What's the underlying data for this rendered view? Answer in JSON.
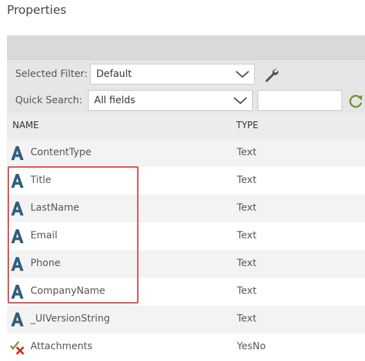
{
  "page": {
    "title": "Properties"
  },
  "filters": {
    "selected_filter_label": "Selected Filter:",
    "selected_filter_value": "Default",
    "quick_search_label": "Quick Search:",
    "quick_search_scope": "All fields",
    "quick_search_text": ""
  },
  "table": {
    "columns": {
      "name": "NAME",
      "type": "TYPE"
    },
    "rows": [
      {
        "name": "ContentType",
        "type": "Text",
        "icon": "text-field-icon"
      },
      {
        "name": "Title",
        "type": "Text",
        "icon": "text-field-icon"
      },
      {
        "name": "LastName",
        "type": "Text",
        "icon": "text-field-icon"
      },
      {
        "name": "Email",
        "type": "Text",
        "icon": "text-field-icon"
      },
      {
        "name": "Phone",
        "type": "Text",
        "icon": "text-field-icon"
      },
      {
        "name": "CompanyName",
        "type": "Text",
        "icon": "text-field-icon"
      },
      {
        "name": "_UIVersionString",
        "type": "Text",
        "icon": "text-field-icon"
      },
      {
        "name": "Attachments",
        "type": "YesNo",
        "icon": "yes-no-field-icon"
      }
    ]
  },
  "colors": {
    "highlight": "#e04848",
    "icon_a": "#2f5f7f",
    "refresh": "#6e9a2e"
  }
}
